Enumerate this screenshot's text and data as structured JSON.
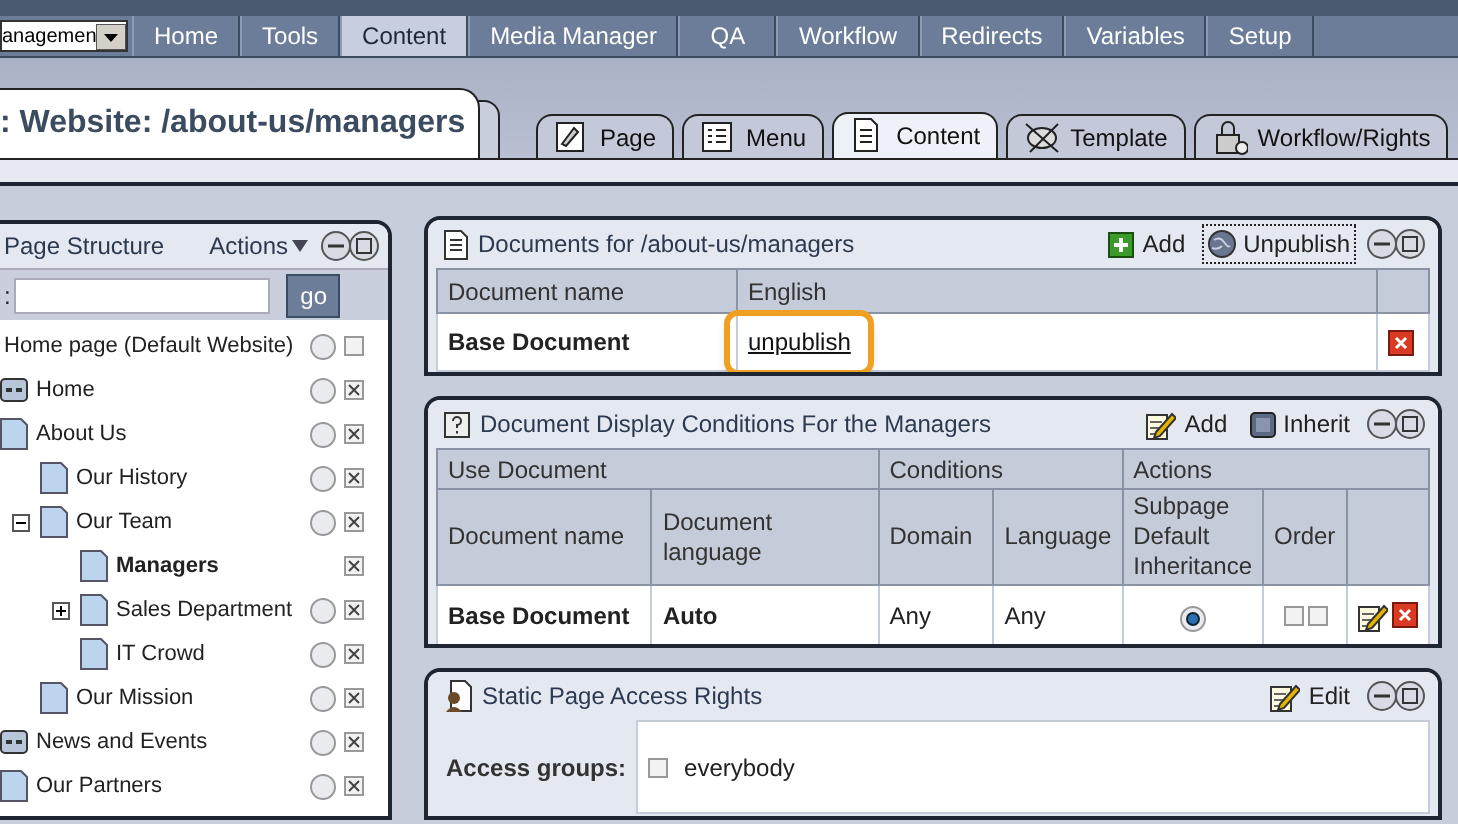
{
  "site_select": {
    "value": "anagemen"
  },
  "menu": [
    {
      "label": "Home",
      "selected": false
    },
    {
      "label": "Tools",
      "selected": false
    },
    {
      "label": "Content",
      "selected": true
    },
    {
      "label": "Media Manager",
      "selected": false
    },
    {
      "label": "QA",
      "selected": false
    },
    {
      "label": "Workflow",
      "selected": false
    },
    {
      "label": "Redirects",
      "selected": false
    },
    {
      "label": "Variables",
      "selected": false
    },
    {
      "label": "Setup",
      "selected": false
    }
  ],
  "page_title": ": Website: /about-us/managers",
  "tabs": [
    {
      "label": "Page",
      "kind": "page",
      "selected": false
    },
    {
      "label": "Menu",
      "kind": "menu",
      "selected": false
    },
    {
      "label": "Content",
      "kind": "content",
      "selected": true
    },
    {
      "label": "Template",
      "kind": "template",
      "selected": false
    },
    {
      "label": "Workflow/Rights",
      "kind": "rights",
      "selected": false
    }
  ],
  "structure": {
    "title": "Page Structure",
    "actions": "Actions",
    "search_label": ":",
    "go": "go",
    "tree": [
      {
        "label": "Home page (Default Website)",
        "kind": "root",
        "selected": false,
        "radio": true,
        "checked": false,
        "children": [
          {
            "label": "Home",
            "kind": "link",
            "selected": false,
            "radio": true,
            "checked": true
          },
          {
            "label": "About Us",
            "kind": "page",
            "selected": false,
            "radio": true,
            "checked": true,
            "children": [
              {
                "label": "Our History",
                "kind": "page",
                "selected": false,
                "radio": true,
                "checked": true
              },
              {
                "label": "Our Team",
                "kind": "page",
                "selected": false,
                "expanded": true,
                "radio": true,
                "checked": true,
                "children": [
                  {
                    "label": "Managers",
                    "kind": "page",
                    "selected": true,
                    "radio": false,
                    "checked": true
                  },
                  {
                    "label": "Sales Department",
                    "kind": "page",
                    "selected": false,
                    "expanded": false,
                    "radio": true,
                    "checked": true
                  },
                  {
                    "label": "IT Crowd",
                    "kind": "page",
                    "selected": false,
                    "radio": true,
                    "checked": true
                  }
                ]
              },
              {
                "label": "Our Mission",
                "kind": "page",
                "selected": false,
                "radio": true,
                "checked": true
              }
            ]
          },
          {
            "label": "News and Events",
            "kind": "link",
            "selected": false,
            "radio": true,
            "checked": true
          },
          {
            "label": "Our Partners",
            "kind": "page",
            "selected": false,
            "radio": true,
            "checked": true
          }
        ]
      }
    ]
  },
  "documents": {
    "title": "Documents for /about-us/managers",
    "actions": [
      {
        "label": "Add",
        "kind": "add",
        "focused": false
      },
      {
        "label": "Unpublish",
        "kind": "globe",
        "focused": true
      }
    ],
    "columns": [
      "Document name",
      "English"
    ],
    "rows": [
      {
        "name": "Base Document",
        "link": "unpublish",
        "highlighted": true
      }
    ]
  },
  "conditions": {
    "title": "Document Display Conditions For the Managers",
    "actions": [
      {
        "label": "Add",
        "kind": "edit"
      },
      {
        "label": "Inherit",
        "kind": "inherit"
      }
    ],
    "groups": [
      {
        "label": "Use Document"
      },
      {
        "label": "Conditions"
      },
      {
        "label": "Actions"
      }
    ],
    "columns": [
      "Document name",
      "Document language",
      "Domain",
      "Language",
      "Subpage Default Inheritance",
      "Order"
    ],
    "rows": [
      {
        "document_name": "Base Document",
        "document_language": "Auto",
        "domain": "Any",
        "language": "Any",
        "inheritance": true,
        "order": [
          {
            "checked": false
          },
          {
            "checked": false
          }
        ]
      }
    ]
  },
  "access": {
    "title": "Static Page Access Rights",
    "actions": [
      {
        "label": "Edit",
        "kind": "edit"
      }
    ],
    "rows": [
      {
        "label": "Access groups:",
        "groups": [
          {
            "name": "everybody",
            "checked": false
          }
        ]
      }
    ]
  }
}
